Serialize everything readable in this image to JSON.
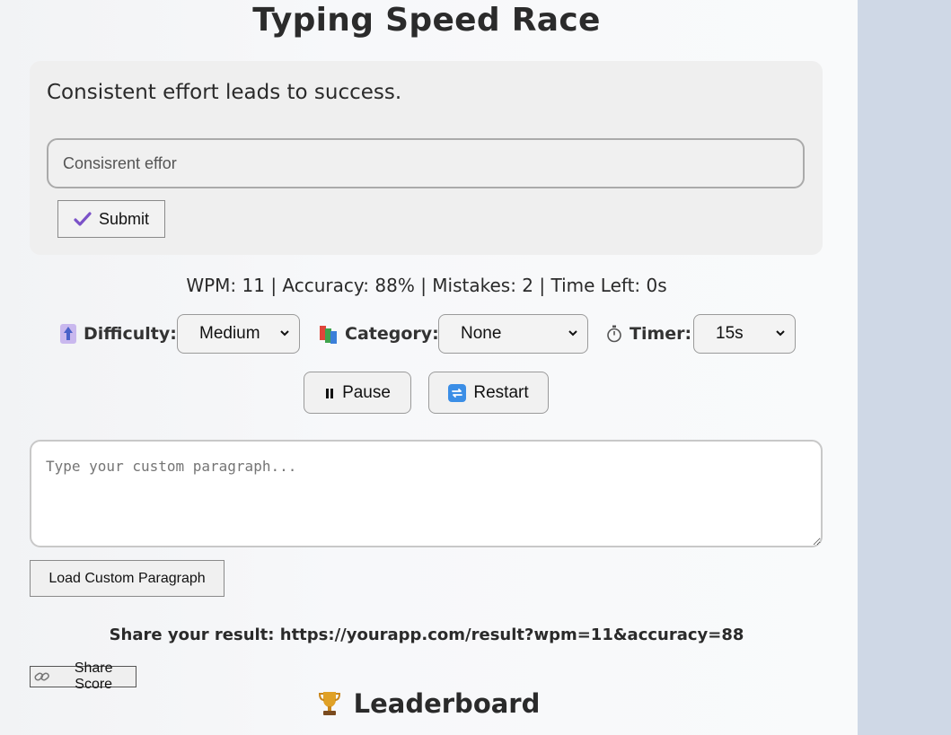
{
  "app": {
    "title": "Typing Speed Race"
  },
  "prompt": {
    "sentence": "Consistent effort leads to success.",
    "input_value": "Consisrent effor",
    "submit_label": "Submit"
  },
  "stats": {
    "text": "WPM: 11 | Accuracy: 88% | Mistakes: 2 | Time Left: 0s",
    "wpm": 11,
    "accuracy_percent": 88,
    "mistakes": 2,
    "time_left_s": 0
  },
  "controls": {
    "difficulty": {
      "label": "Difficulty:",
      "value": "Medium",
      "icon": "up-arrow-icon"
    },
    "category": {
      "label": "Category:",
      "value": "None",
      "icon": "books-icon"
    },
    "timer": {
      "label": "Timer:",
      "value": "15s",
      "icon": "stopwatch-icon"
    }
  },
  "actions": {
    "pause_label": "Pause",
    "restart_label": "Restart"
  },
  "custom": {
    "placeholder": "Type your custom paragraph...",
    "load_label": "Load Custom Paragraph"
  },
  "share": {
    "text": "Share your result: https://yourapp.com/result?wpm=11&accuracy=88",
    "button_label": "Share Score",
    "icon": "link-icon"
  },
  "leaderboard": {
    "title": "Leaderboard",
    "icon": "trophy-icon"
  },
  "colors": {
    "page_bg": "#f7f8fa",
    "side_bg": "#cfd8e6",
    "card_bg": "#efefef",
    "check": "#7b52c8",
    "restart_icon": "#3b8ee6"
  }
}
